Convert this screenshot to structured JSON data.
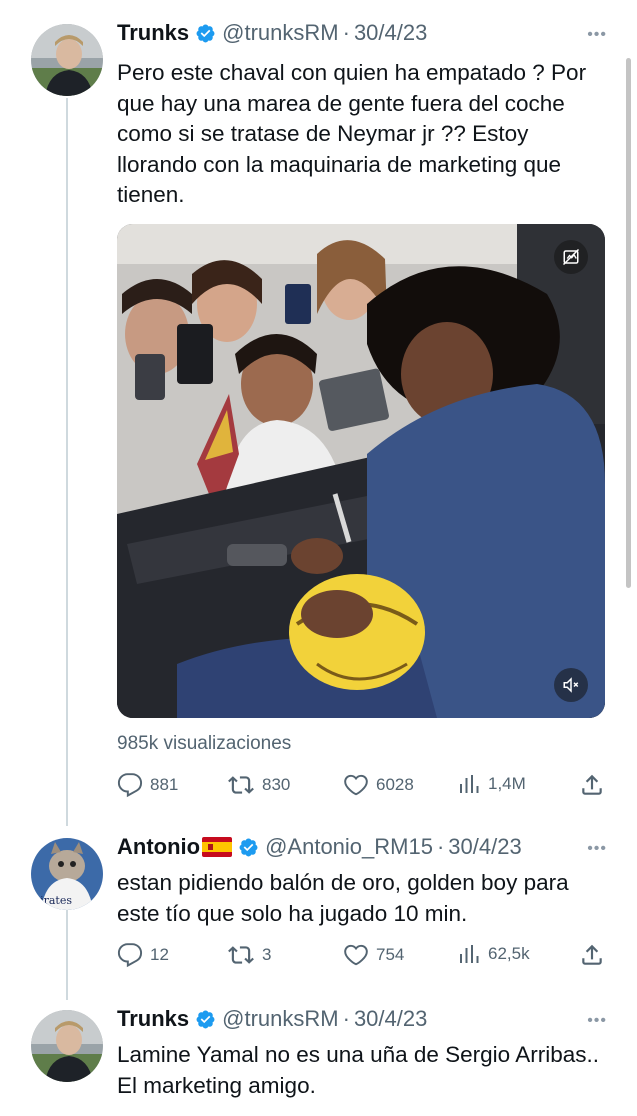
{
  "tweets": [
    {
      "name": "Trunks",
      "handle": "@trunksRM",
      "separator": "·",
      "date": "30/4/23",
      "more": "•••",
      "text": "Pero este chaval con quien ha empatado ? Por que hay una marea de gente fuera del coche como si se tratase de Neymar jr ?? Estoy llorando con la maquinaria de marketing que tienen.",
      "views": "985k visualizaciones",
      "stats": {
        "replies": "881",
        "retweets": "830",
        "likes": "6028",
        "view_count": "1,4M"
      },
      "media_icons": [
        "sensitive-content-icon",
        "mute-icon"
      ]
    },
    {
      "name": "Antonio",
      "handle": "@Antonio_RM15",
      "separator": "·",
      "date": "30/4/23",
      "more": "•••",
      "text": "estan pidiendo balón de oro, golden boy para este tío que solo ha jugado 10 min.",
      "avatar_text": "nirates",
      "stats": {
        "replies": "12",
        "retweets": "3",
        "likes": "754",
        "view_count": "62,5k"
      }
    },
    {
      "name": "Trunks",
      "handle": "@trunksRM",
      "separator": "·",
      "date": "30/4/23",
      "more": "•••",
      "text": "Lamine Yamal no es una uña de Sergio Arribas.. El marketing amigo."
    }
  ],
  "colors": {
    "verified": "#1d9bf0",
    "muted_text": "#536471",
    "thread_line": "#cfd9de",
    "primary_text": "#0f1419"
  }
}
